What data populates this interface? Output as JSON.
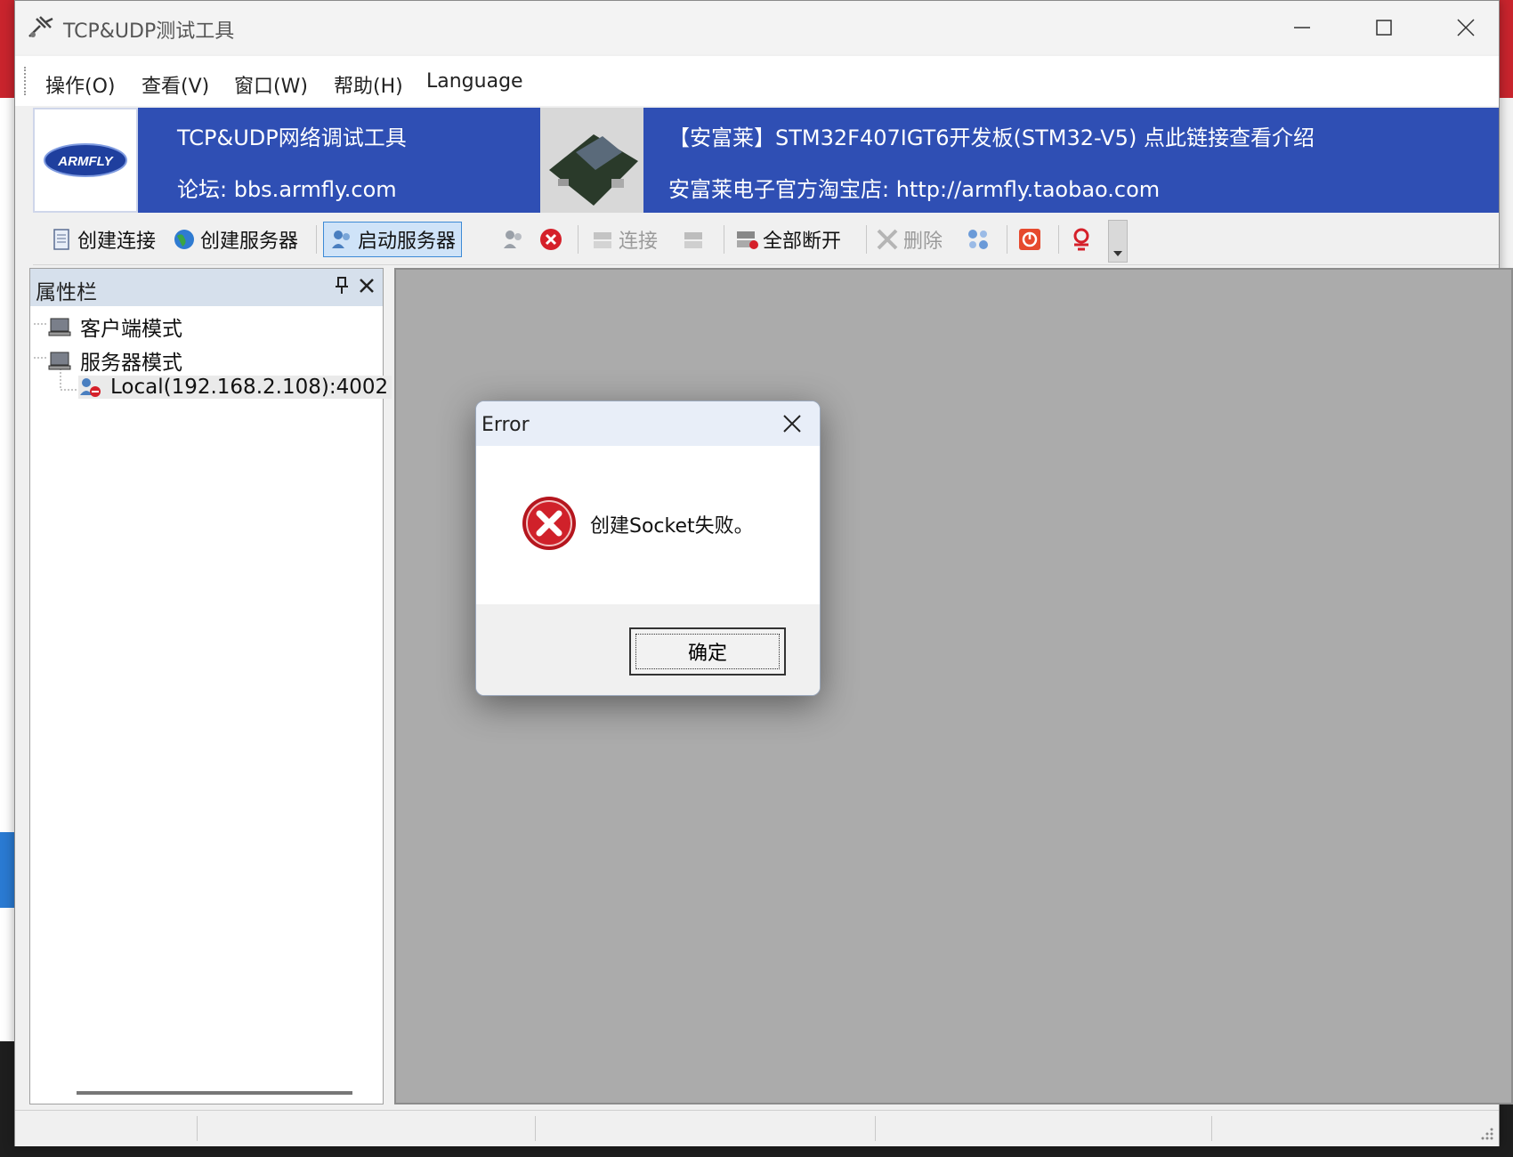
{
  "window": {
    "title": "TCP&UDP测试工具"
  },
  "menu": [
    "操作(O)",
    "查看(V)",
    "窗口(W)",
    "帮助(H)",
    "Language"
  ],
  "banner": {
    "logo_text": "ARMFLY",
    "app_name": "TCP&UDP网络调试工具",
    "forum": "论坛: bbs.armfly.com",
    "promo": "【安富莱】STM32F407IGT6开发板(STM32-V5) 点此链接查看介绍",
    "shop": "安富莱电子官方淘宝店: http://armfly.taobao.com"
  },
  "toolbar": {
    "create_connection": "创建连接",
    "create_server": "创建服务器",
    "start_server": "启动服务器",
    "connect": "连接",
    "disconnect_all": "全部断开",
    "delete": "删除"
  },
  "panel": {
    "title": "属性栏",
    "tree": [
      "客户端模式",
      "服务器模式",
      "Local(192.168.2.108):4002"
    ]
  },
  "dialog": {
    "title": "Error",
    "message": "创建Socket失败。",
    "ok_label": "确定"
  },
  "colors": {
    "banner_bg": "#2f4fb4",
    "mdi_bg": "#ababab",
    "error_red": "#d0212a"
  }
}
